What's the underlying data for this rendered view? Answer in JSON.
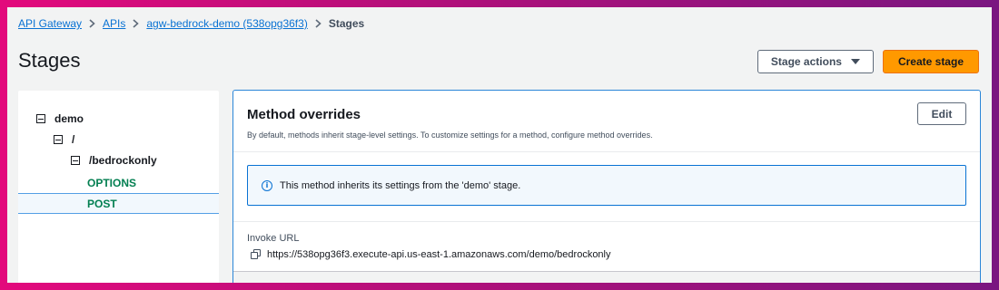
{
  "breadcrumb": {
    "items": [
      "API Gateway",
      "APIs",
      "agw-bedrock-demo (538opg36f3)"
    ],
    "current": "Stages"
  },
  "page": {
    "title": "Stages",
    "stage_actions_label": "Stage actions",
    "create_stage_label": "Create stage"
  },
  "tree": {
    "stage": "demo",
    "root": "/",
    "resource": "/bedrockonly",
    "methods": [
      "OPTIONS",
      "POST"
    ],
    "selected": "POST"
  },
  "details": {
    "title": "Method overrides",
    "description": "By default, methods inherit stage-level settings. To customize settings for a method, configure method overrides.",
    "edit_label": "Edit",
    "info_icon_glyph": "i",
    "info_message": "This method inherits its settings from the 'demo' stage.",
    "invoke_label": "Invoke URL",
    "invoke_url": "https://538opg36f3.execute-api.us-east-1.amazonaws.com/demo/bedrockonly"
  },
  "icons": {
    "breadcrumb_separator": "chevron-right-icon",
    "stage_actions": "caret-down-icon",
    "tree_toggle": "collapse-icon",
    "info": "info-icon",
    "copy": "copy-icon"
  },
  "colors": {
    "link": "#0972d3",
    "primary_button": "#ff9900",
    "method": "#037f51",
    "selection_border": "#539fe5",
    "info_background": "#f2f8fd"
  }
}
